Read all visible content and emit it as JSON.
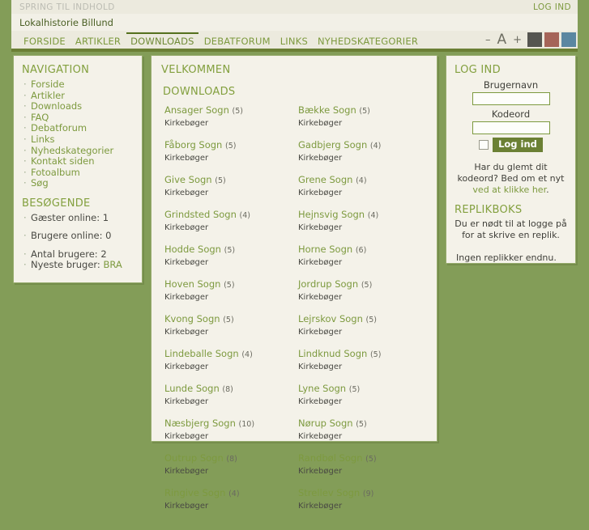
{
  "header": {
    "skip_link": "SPRING TIL INDHOLD",
    "login_top": "LOG IND",
    "site_title": "Lokalhistorie Billund",
    "nav": [
      {
        "label": "FORSIDE",
        "active": false
      },
      {
        "label": "ARTIKLER",
        "active": false
      },
      {
        "label": "DOWNLOADS",
        "active": true
      },
      {
        "label": "DEBATFORUM",
        "active": false
      },
      {
        "label": "LINKS",
        "active": false
      },
      {
        "label": "NYHEDSKATEGORIER",
        "active": false
      }
    ],
    "font_decrease": "–",
    "font_label": "A",
    "font_increase": "+",
    "swatches": [
      "#555550",
      "#a56458",
      "#5b87a1"
    ]
  },
  "sidebar": {
    "nav_title": "NAVIGATION",
    "nav_items": [
      "Forside",
      "Artikler",
      "Downloads",
      "FAQ",
      "Debatforum",
      "Links",
      "Nyhedskategorier",
      "Kontakt siden",
      "Fotoalbum",
      "Søg"
    ],
    "visitors_title": "BESØGENDE",
    "stats": [
      {
        "label": "Gæster online: 1",
        "link": null
      },
      {
        "label": "Brugere online: 0",
        "link": null
      },
      {
        "label": "Antal brugere: 2",
        "link": null
      },
      {
        "label": "Nyeste bruger: ",
        "link": "BRA"
      }
    ]
  },
  "content": {
    "welcome_title": "VELKOMMEN",
    "downloads_title": "DOWNLOADS",
    "sub_label": "Kirkebøger",
    "downloads": [
      {
        "name": "Ansager Sogn",
        "count": "(5)"
      },
      {
        "name": "Bække Sogn",
        "count": "(5)"
      },
      {
        "name": "Fåborg Sogn",
        "count": "(5)"
      },
      {
        "name": "Gadbjerg Sogn",
        "count": "(4)"
      },
      {
        "name": "Give Sogn",
        "count": "(5)"
      },
      {
        "name": "Grene Sogn",
        "count": "(4)"
      },
      {
        "name": "Grindsted Sogn",
        "count": "(4)"
      },
      {
        "name": "Hejnsvig Sogn",
        "count": "(4)"
      },
      {
        "name": "Hodde Sogn",
        "count": "(5)"
      },
      {
        "name": "Horne Sogn",
        "count": "(6)"
      },
      {
        "name": "Hoven Sogn",
        "count": "(5)"
      },
      {
        "name": "Jordrup Sogn",
        "count": "(5)"
      },
      {
        "name": "Kvong Sogn",
        "count": "(5)"
      },
      {
        "name": "Lejrskov Sogn",
        "count": "(5)"
      },
      {
        "name": "Lindeballe Sogn",
        "count": "(4)"
      },
      {
        "name": "Lindknud Sogn",
        "count": "(5)"
      },
      {
        "name": "Lunde Sogn",
        "count": "(8)"
      },
      {
        "name": "Lyne Sogn",
        "count": "(5)"
      },
      {
        "name": "Næsbjerg Sogn",
        "count": "(10)"
      },
      {
        "name": "Nørup Sogn",
        "count": "(5)"
      },
      {
        "name": "Outrup Sogn",
        "count": "(8)"
      },
      {
        "name": "Randbøl Sogn",
        "count": "(5)"
      },
      {
        "name": "Ringive Sogn",
        "count": "(4)"
      },
      {
        "name": "Strellev Sogn",
        "count": "(9)"
      }
    ]
  },
  "login": {
    "title": "LOG IND",
    "username_label": "Brugernavn",
    "username_value": "",
    "password_label": "Kodeord",
    "password_value": "",
    "submit_label": "Log ind",
    "forgot_line1": "Har du glemt dit kodeord?",
    "forgot_line2": "Bed om et nyt ",
    "forgot_link": "ved at klikke her",
    "forgot_end": ".",
    "replik_title": "REPLIKBOKS",
    "replik_text": "Du er nødt til at logge på for at skrive en replik.",
    "replik_none": "Ingen replikker endnu."
  }
}
